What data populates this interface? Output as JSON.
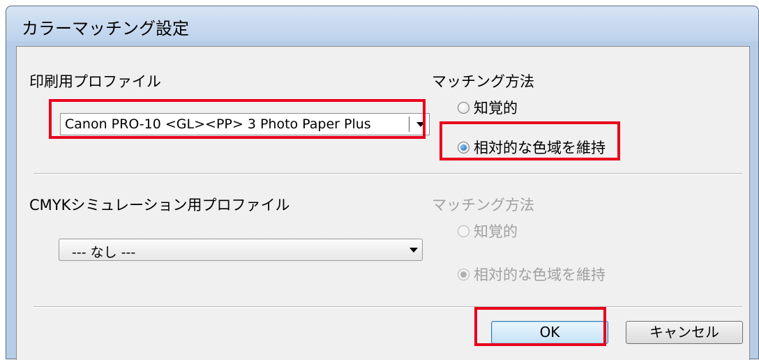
{
  "window": {
    "title": "カラーマッチング設定"
  },
  "print_profile": {
    "label": "印刷用プロファイル",
    "selected": "Canon PRO-10 <GL><PP> 3 Photo Paper Plus"
  },
  "matching": {
    "label": "マッチング方法",
    "options": [
      "知覚的",
      "相対的な色域を維持"
    ],
    "selected_index": 1
  },
  "cmyk_profile": {
    "label": "CMYKシミュレーション用プロファイル",
    "selected": "--- なし ---"
  },
  "cmyk_matching": {
    "label": "マッチング方法",
    "options": [
      "知覚的",
      "相対的な色域を維持"
    ],
    "selected_index": 1,
    "disabled": true
  },
  "buttons": {
    "ok": "OK",
    "cancel": "キャンセル"
  },
  "colors": {
    "highlight": "#e8001c",
    "titlebar": "#bdd2ec",
    "client": "#f0f0f0",
    "disabled_text": "#a0a0a0"
  }
}
